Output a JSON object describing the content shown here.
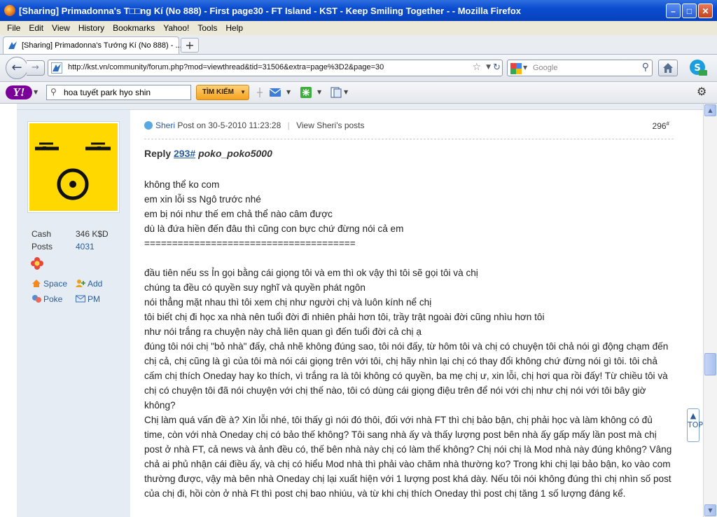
{
  "window": {
    "title": "[Sharing] Primadonna's T□□ng Kí (No 888) - First page30 - FT Island - KST - Keep Smiling Together - - Mozilla Firefox",
    "minimize": "–",
    "maximize": "□",
    "close": "✕"
  },
  "menu": [
    "File",
    "Edit",
    "View",
    "History",
    "Bookmarks",
    "Yahoo!",
    "Tools",
    "Help"
  ],
  "tab": {
    "label": "[Sharing] Primadonna's Tướng Kí (No 888) - ...",
    "new_tab": "+"
  },
  "nav": {
    "url": "http://kst.vn/community/forum.php?mod=viewthread&tid=31506&extra=page%3D2&page=30",
    "search_placeholder": "Google"
  },
  "yahoo": {
    "search_value": "hoa tuyết park hyo shin",
    "search_button": "TÌM KIẾM"
  },
  "sidebar": {
    "stats": [
      {
        "key": "Cash",
        "value": "346 K$D"
      },
      {
        "key": "Posts",
        "value": "4031"
      }
    ],
    "links": {
      "space": "Space",
      "add": "Add",
      "poke": "Poke",
      "pm": "PM"
    }
  },
  "post": {
    "author": "Sheri",
    "posted": "Post on 30-5-2010 11:23:28",
    "view_posts": "View Sheri's posts",
    "number": "296",
    "number_sup": "#",
    "reply_label": "Reply",
    "reply_ref": "293#",
    "reply_user": "poko_poko5000",
    "lines": [
      "không thể ko com",
      "em xin lỗi ss Ngô trước nhé",
      "em bị nói như thế em chả thể nào câm được",
      "dù là đứa hiền đến đâu thì cũng con bực chứ đừng nói cả em",
      "======================================",
      "",
      "đầu tiên nếu ss Ỉn gọi bằng cái giọng tôi và em thì ok vậy thì tôi sẽ gọi tôi và chị",
      "chúng ta đều có quyền suy nghĩ và quyền phát ngôn",
      "nói thẳng mặt nhau thì tôi xem chị như người chị và luôn kính nể chị",
      "tôi biết chị đi học xa nhà nên tuổi đời đi nhiên phải hơn tôi, trầy trật ngoài đời cũng nhìu hơn tôi",
      "như nói trắng ra chuyện này chả liên quan gì đến tuổi đời cả chị ạ",
      "đúng tôi nói chị \"bỏ nhà\" đấy, chả nhẽ không đúng sao, tôi nói đấy, từ hôm tôi và chị có chuyện tôi chả nói gì động chạm đến chị cả, chị cũng là gì của tôi mà nói cái giọng trên với tôi, chị hãy nhìn lại chị có thay đổi không chứ đừng nói gì tôi. tôi chả cấm chị thích Oneday hay ko thích, vì trắng ra là tôi không có quyền, ba mẹ chị ư, xin lỗi, chị hơi qua rồi đấy! Từ chiều tôi và chị có chuyện tôi đã nói chuyện với chị thế nào, tôi có dùng cái giọng điệu trên để nói với chị như chị nói với tôi bây giờ không?",
      "Chị làm quá vấn đề à? Xin lỗi nhé, tôi thấy gì nói đó thôi, đối với nhà FT thì chị bảo bận, chị phải học và làm không có đủ time, còn với nhà Oneday chị có bảo thế không? Tôi sang nhà ấy và thấy lượng post bên nhà ấy gấp mấy lần post mà chị post ở nhà FT, cả news và ảnh đều có, thế bên nhà này chị có làm thế không? Chị nói chị là Mod nhà này đúng không? Vâng chả ai phủ nhận cái điều ấy, và chị có hiểu Mod nhà thì phải vào chăm nhà thường ko? Trong khi chị lại bảo bận, ko vào com thường được, vậy mà bên nhà Oneday chị lại xuất hiện với 1 lượng post khá dày. Nếu tôi nói không đúng thì chị nhìn số post của chị đi, hồi còn ở nhà Ft thì post chị bao nhiúu, và từ khi chị thích Oneday thì post chị tăng 1 số lượng đáng kể."
    ]
  },
  "float_top": "▲ TOP"
}
